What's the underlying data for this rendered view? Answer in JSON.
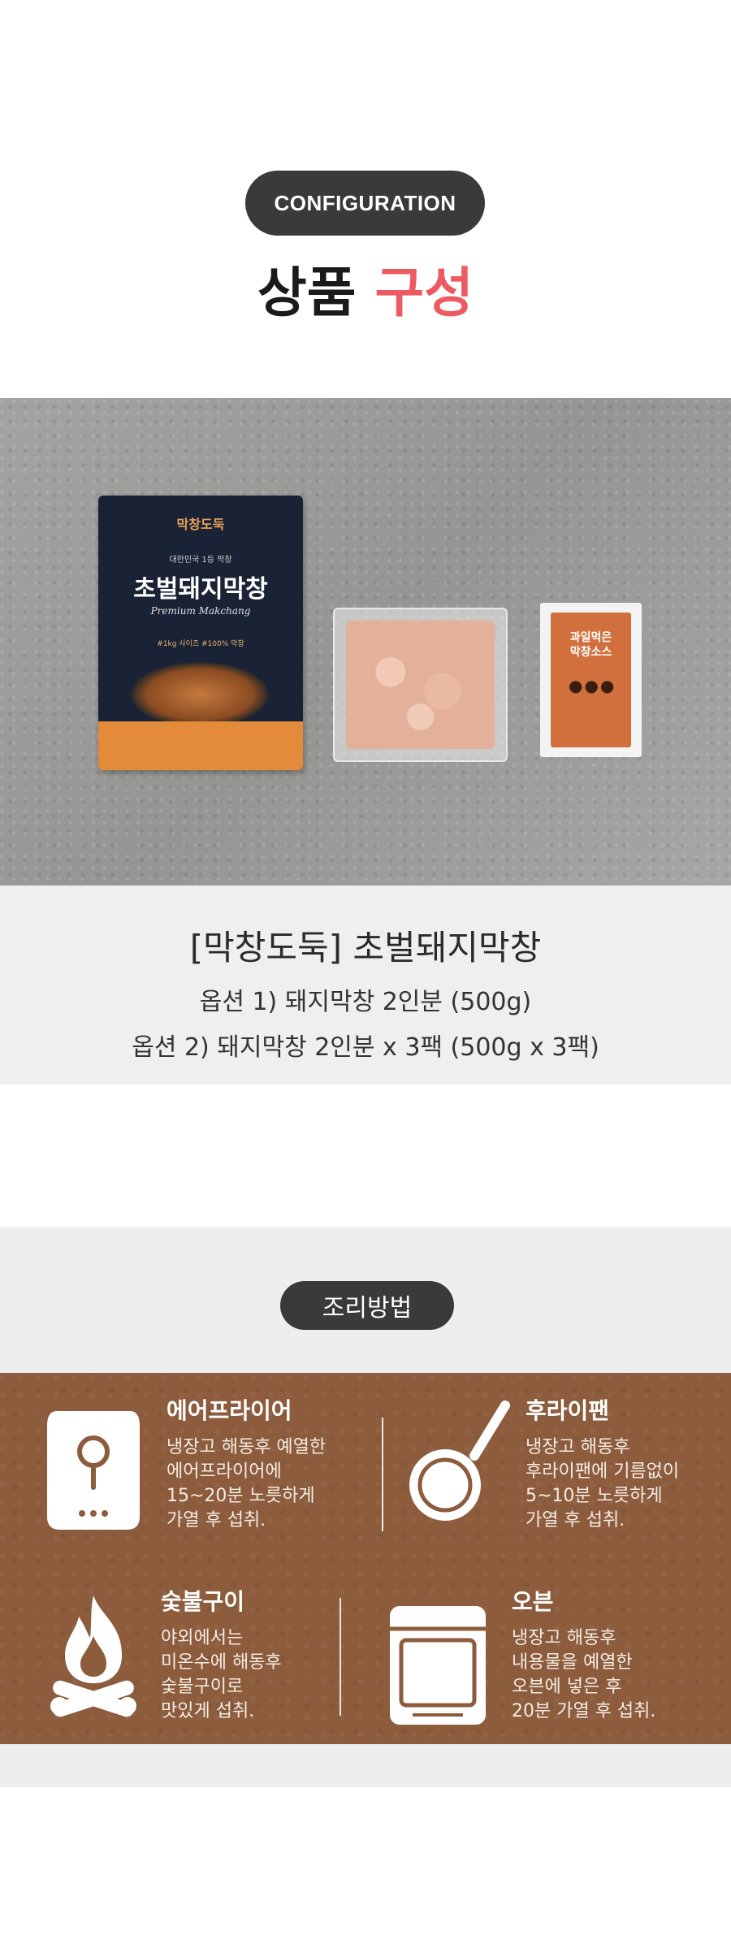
{
  "header": {
    "pill_label": "CONFIGURATION",
    "title_main": "상품",
    "title_accent": "구성"
  },
  "photo": {
    "pouch": {
      "brand": "막창도둑",
      "tagline": "대한민국 1등 막창",
      "name": "초벌돼지막창",
      "script": "Premium Makchang",
      "note": "#1kg 사이즈 #100% 막창"
    },
    "sauce": {
      "label_line1": "과일먹은",
      "label_line2": "막창소스"
    }
  },
  "info": {
    "product_name": "[막창도둑] 초벌돼지막창",
    "option1": "옵션 1) 돼지막창 2인분 (500g)",
    "option2": "옵션 2) 돼지막창 2인분 x 3팩 (500g x 3팩)"
  },
  "cooking": {
    "pill_label": "조리방법",
    "methods": [
      {
        "title": "에어프라이어",
        "lines": [
          "냉장고 해동후 예열한",
          "에어프라이어에",
          "15~20분 노릇하게",
          "가열 후 섭취."
        ],
        "icon": "air-fryer-icon"
      },
      {
        "title": "후라이팬",
        "lines": [
          "냉장고 해동후",
          "후라이팬에 기름없이",
          "5~10분 노릇하게",
          "가열 후 섭취."
        ],
        "icon": "frying-pan-icon"
      },
      {
        "title": "숯불구이",
        "lines": [
          "야외에서는",
          "미온수에 해동후",
          "숯불구이로",
          "맛있게 섭취."
        ],
        "icon": "campfire-icon"
      },
      {
        "title": "오븐",
        "lines": [
          "냉장고 해동후",
          "내용물을 예열한",
          "오븐에 넣은 후",
          "20분 가열 후 섭취."
        ],
        "icon": "oven-icon"
      }
    ]
  },
  "colors": {
    "accent": "#ee5a63",
    "pill": "#3a3a3a",
    "board": "#8c5c3d",
    "info_bg": "#efefef"
  }
}
